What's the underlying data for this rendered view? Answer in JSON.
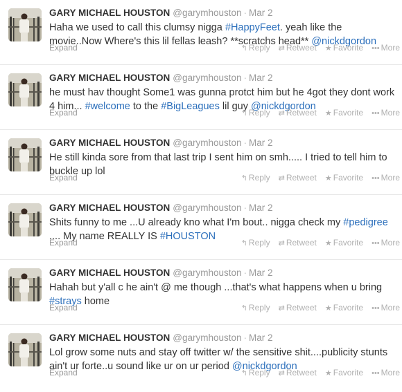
{
  "ui": {
    "expand_label": "Expand",
    "reply_label": "Reply",
    "retweet_label": "Retweet",
    "favorite_label": "Favorite",
    "more_label": "More",
    "separator": "·"
  },
  "icons": {
    "reply": "reply-icon",
    "retweet": "retweet-icon",
    "favorite": "star-icon",
    "more": "ellipsis-icon"
  },
  "colors": {
    "link": "#2a6ebb",
    "muted": "#999999",
    "name": "#333333"
  },
  "tweets": [
    {
      "fullname": "GARY MICHAEL HOUSTON",
      "username": "@garymhouston",
      "time": "Mar 2",
      "parts": [
        {
          "t": "Haha we used to call this clumsy nigga "
        },
        {
          "t": "#HappyFeet",
          "link": true
        },
        {
          "t": ". yeah like the movie..Now Where's this lil fellas leash? **scratchs head** "
        },
        {
          "t": "@nickdgordon",
          "link": true
        }
      ]
    },
    {
      "fullname": "GARY MICHAEL HOUSTON",
      "username": "@garymhouston",
      "time": "Mar 2",
      "parts": [
        {
          "t": "he must hav thought Some1 was gunna protct him but he 4got they dont work 4 him... "
        },
        {
          "t": "#welcome",
          "link": true
        },
        {
          "t": " to the "
        },
        {
          "t": "#BigLeagues",
          "link": true
        },
        {
          "t": " lil guy  "
        },
        {
          "t": "@nickdgordon",
          "link": true
        }
      ]
    },
    {
      "fullname": "GARY MICHAEL HOUSTON",
      "username": "@garymhouston",
      "time": "Mar 2",
      "parts": [
        {
          "t": "He still kinda sore from that last trip I sent him on smh..... I tried to tell him to buckle up lol"
        }
      ]
    },
    {
      "fullname": "GARY MICHAEL HOUSTON",
      "username": "@garymhouston",
      "time": "Mar 2",
      "parts": [
        {
          "t": "Shits funny to me ...U already kno  what I'm bout.. nigga check my "
        },
        {
          "t": "#pedigree",
          "link": true
        },
        {
          "t": " .... My name REALLY IS "
        },
        {
          "t": "#HOUSTON",
          "link": true
        }
      ]
    },
    {
      "fullname": "GARY MICHAEL HOUSTON",
      "username": "@garymhouston",
      "time": "Mar 2",
      "parts": [
        {
          "t": "Hahah but y'all c he ain't @ me though ...that's what happens when u bring "
        },
        {
          "t": "#strays",
          "link": true
        },
        {
          "t": " home"
        }
      ]
    },
    {
      "fullname": "GARY MICHAEL HOUSTON",
      "username": "@garymhouston",
      "time": "Mar 2",
      "parts": [
        {
          "t": "Lol grow some nuts and  stay off twitter w/ the sensitive shit....publicity stunts ain't ur forte..u sound like ur on ur period "
        },
        {
          "t": "@nickdgordon",
          "link": true
        }
      ]
    }
  ]
}
